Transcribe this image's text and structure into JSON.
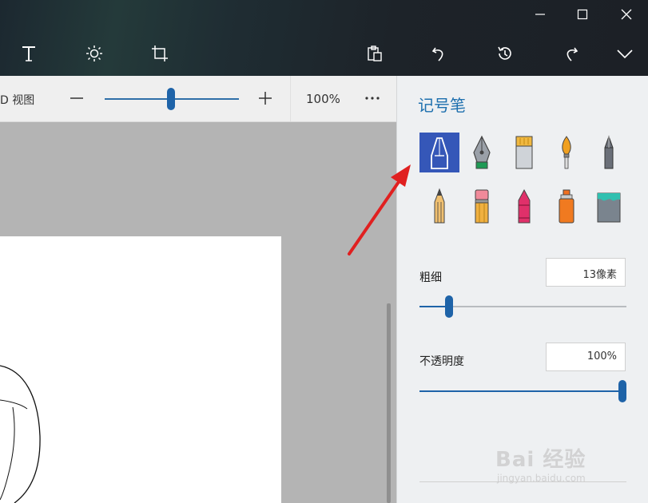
{
  "window": {
    "minimize_icon": "minimize-icon",
    "maximize_icon": "maximize-icon",
    "close_icon": "close-icon"
  },
  "toolbar": {
    "items": [
      "text-icon",
      "effects-icon",
      "crop-icon",
      "paste-icon",
      "undo-icon",
      "history-icon",
      "redo-icon",
      "chevron-down-icon"
    ]
  },
  "viewbar": {
    "view_label": "D 视图",
    "zoom_percent": "100%",
    "zoom_level": 0.5
  },
  "panel": {
    "title": "记号笔",
    "selected_brush": "marker",
    "brushes": [
      "marker",
      "calligraphy-pen",
      "oil-brush",
      "watercolor",
      "pixel-pen",
      "pencil",
      "eraser",
      "crayon",
      "spray-can",
      "fill"
    ],
    "thickness": {
      "label": "粗细",
      "value": "13像素",
      "level": 0.13
    },
    "opacity": {
      "label": "不透明度",
      "value": "100%",
      "level": 1.0
    }
  },
  "colors": {
    "accent": "#1e63a8",
    "selected_tile": "#3557b8",
    "annotation_arrow": "#e02020"
  },
  "watermark": {
    "brand": "Bai 经验",
    "url": "jingyan.baidu.com"
  }
}
